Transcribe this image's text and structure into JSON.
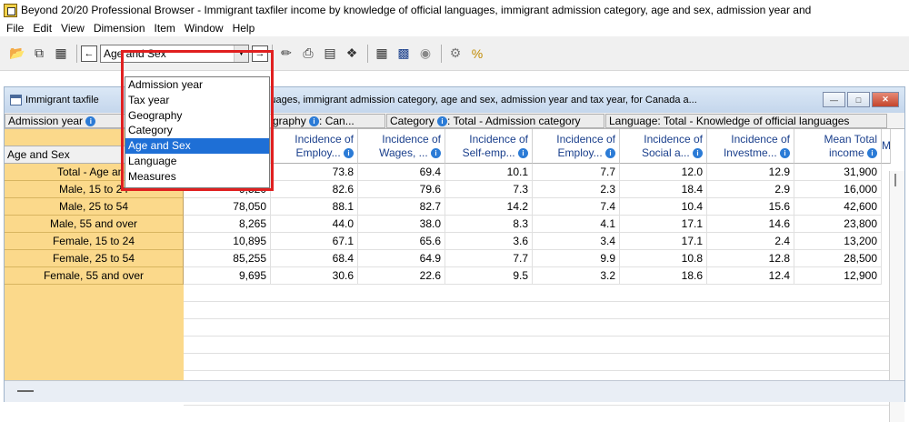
{
  "window": {
    "title": "Beyond 20/20 Professional Browser - Immigrant taxfiler income by knowledge of official languages, immigrant admission category, age and sex, admission year and"
  },
  "menu": [
    "File",
    "Edit",
    "View",
    "Dimension",
    "Item",
    "Window",
    "Help"
  ],
  "toolbar": {
    "dimension_selected": "Age and Sex",
    "icons": [
      "open-icon",
      "copy-icon",
      "grid-icon",
      "prev-dimension-icon",
      "next-dimension-icon",
      "pencil-icon",
      "print-icon",
      "chart-icon",
      "filter-icon",
      "table-icon",
      "bar-chart-icon",
      "globe-icon",
      "gear-icon",
      "percent-icon"
    ]
  },
  "dropdown": {
    "options": [
      "Admission year",
      "Tax year",
      "Geography",
      "Category",
      "Age and Sex",
      "Language",
      "Measures"
    ],
    "selected_index": 4
  },
  "inner_window": {
    "title_left": "Immigrant taxfile",
    "title_right": "fficial languages, immigrant admission category, age and sex, admission year and tax year, for Canada a...",
    "accent": "#dbe8f6"
  },
  "dimension_bar": {
    "admission": "Admission year",
    "geography": "graphy",
    "geography_value": ": Can...",
    "category": "Category",
    "category_value": ": Total - Admission category",
    "language": "Language: Total - Knowledge of official languages"
  },
  "table": {
    "row_dimension_label": "Age and Sex",
    "columns": [
      {
        "l1": "",
        "l2": ""
      },
      {
        "l1": "Incidence of",
        "l2": "Employ..."
      },
      {
        "l1": "Incidence of",
        "l2": "Wages, ..."
      },
      {
        "l1": "Incidence of",
        "l2": "Self-emp..."
      },
      {
        "l1": "Incidence of",
        "l2": "Employ..."
      },
      {
        "l1": "Incidence of",
        "l2": "Social a..."
      },
      {
        "l1": "Incidence of",
        "l2": "Investme..."
      },
      {
        "l1": "Mean Total",
        "l2": "income"
      },
      {
        "l1": "M",
        "l2": ""
      }
    ],
    "rows": [
      {
        "label": "Total - Age and",
        "values": [
          "",
          "73.8",
          "69.4",
          "10.1",
          "7.7",
          "12.0",
          "12.9",
          "31,900"
        ]
      },
      {
        "label": "Male, 15 to 24",
        "values": [
          "9,520",
          "82.6",
          "79.6",
          "7.3",
          "2.3",
          "18.4",
          "2.9",
          "16,000"
        ]
      },
      {
        "label": "Male, 25 to 54",
        "values": [
          "78,050",
          "88.1",
          "82.7",
          "14.2",
          "7.4",
          "10.4",
          "15.6",
          "42,600"
        ]
      },
      {
        "label": "Male, 55 and over",
        "values": [
          "8,265",
          "44.0",
          "38.0",
          "8.3",
          "4.1",
          "17.1",
          "14.6",
          "23,800"
        ]
      },
      {
        "label": "Female, 15 to 24",
        "values": [
          "10,895",
          "67.1",
          "65.6",
          "3.6",
          "3.4",
          "17.1",
          "2.4",
          "13,200"
        ]
      },
      {
        "label": "Female, 25 to 54",
        "values": [
          "85,255",
          "68.4",
          "64.9",
          "7.7",
          "9.9",
          "10.8",
          "12.8",
          "28,500"
        ]
      },
      {
        "label": "Female, 55 and over",
        "values": [
          "9,695",
          "30.6",
          "22.6",
          "9.5",
          "3.2",
          "18.6",
          "12.4",
          "12,900"
        ]
      }
    ]
  },
  "colors": {
    "row_header": "#fbd98b",
    "column_header_text": "#1a3f8c",
    "selection": "#1e6fd6",
    "callout_border": "#e02020"
  }
}
